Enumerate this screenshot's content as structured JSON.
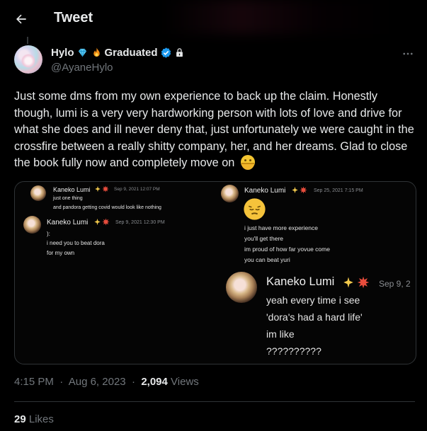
{
  "header": {
    "title": "Tweet"
  },
  "author": {
    "name": "Hylo",
    "badge_text": "Graduated",
    "handle": "@AyaneHylo"
  },
  "tweet": {
    "text": "Just some dms from my own experience to back up the claim. Honestly though, lumi is a very very hardworking person with lots of love and drive for what she does and ill never deny that, just unfortunately we were caught in the crossfire between a really shitty company, her, and her dreams. Glad to close the book fully now and completely move on",
    "time": "4:15 PM",
    "date": "Aug 6, 2023",
    "views_count": "2,094",
    "views_label": "Views",
    "likes_count": "29",
    "likes_label": "Likes"
  },
  "media": {
    "dm1": {
      "name": "Kaneko Lumi",
      "date": "Sep 9, 2021 12:07 PM",
      "lines": [
        "just one thing",
        "and pandora getting covid would look like nothing"
      ]
    },
    "dm2": {
      "name": "Kaneko Lumi",
      "date": "Sep 9, 2021 12:30 PM",
      "lines": [
        "):",
        "i need you to beat dora",
        "for my own"
      ]
    },
    "dm3": {
      "name": "Kaneko Lumi",
      "date": "Sep 25, 2021 7:15 PM",
      "lines": [
        "i just have more experience",
        "you'll get there",
        "im proud of how far yovue come",
        "you can beat yuri"
      ]
    },
    "dm4": {
      "name": "Kaneko Lumi",
      "date": "Sep 9, 2",
      "lines": [
        "yeah every time i see",
        "'dora's had a hard life'",
        "im like",
        "??????????"
      ]
    }
  },
  "colors": {
    "background": "#000000",
    "text_primary": "#e7e9ea",
    "text_secondary": "#71767b",
    "verified_blue": "#1d9bf0"
  },
  "icons": [
    "back-arrow-icon",
    "diamond-icon",
    "fire-icon",
    "verified-icon",
    "lock-icon",
    "more-icon",
    "hugging-face-icon",
    "sparkle-icon",
    "collision-icon",
    "pensive-face-icon"
  ]
}
